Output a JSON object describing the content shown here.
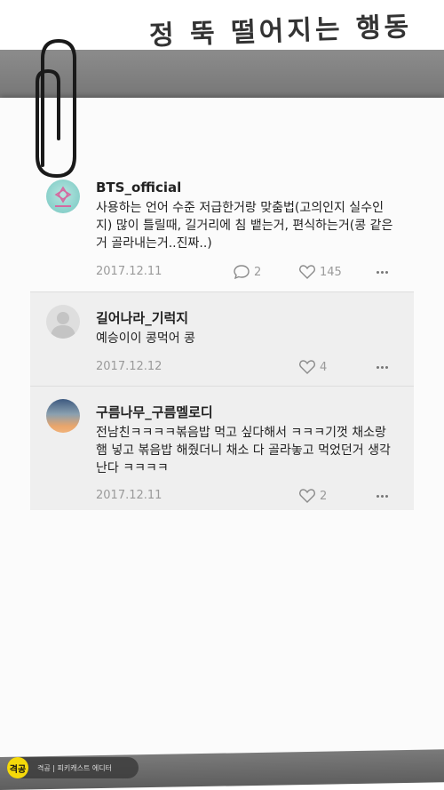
{
  "header": {
    "title": "정 뚝 떨어지는 행동"
  },
  "comments": [
    {
      "username": "BTS_official",
      "text": "사용하는 언어 수준 저급한거랑 맞춤법(고의인지 실수인지) 많이 틀릴때, 길거리에 침 뱉는거, 편식하는거(콩 같은거 골라내는거..진짜..)",
      "date": "2017.12.11",
      "reply_count": "2",
      "like_count": "145"
    },
    {
      "username": "길어나라_기럭지",
      "text": "예승이이 콩먹어 콩",
      "date": "2017.12.12",
      "like_count": "4"
    },
    {
      "username": "구름나무_구름멜로디",
      "text": "전남친ㅋㅋㅋㅋ볶음밥 먹고 싶다해서 ㅋㅋㅋ기껏 채소랑 햄 넣고 볶음밥 해줬더니 채소 다 골라놓고 먹었던거 생각난다 ㅋㅋㅋㅋ",
      "date": "2017.12.11",
      "like_count": "2"
    }
  ],
  "footer": {
    "logo_text": "격공",
    "text": "격공 | 피키캐스트 에디터"
  },
  "colors": {
    "band": "#7a7a7a",
    "reply_bg": "#efefef",
    "meta": "#9a9a9a",
    "logo": "#f5d90a"
  }
}
